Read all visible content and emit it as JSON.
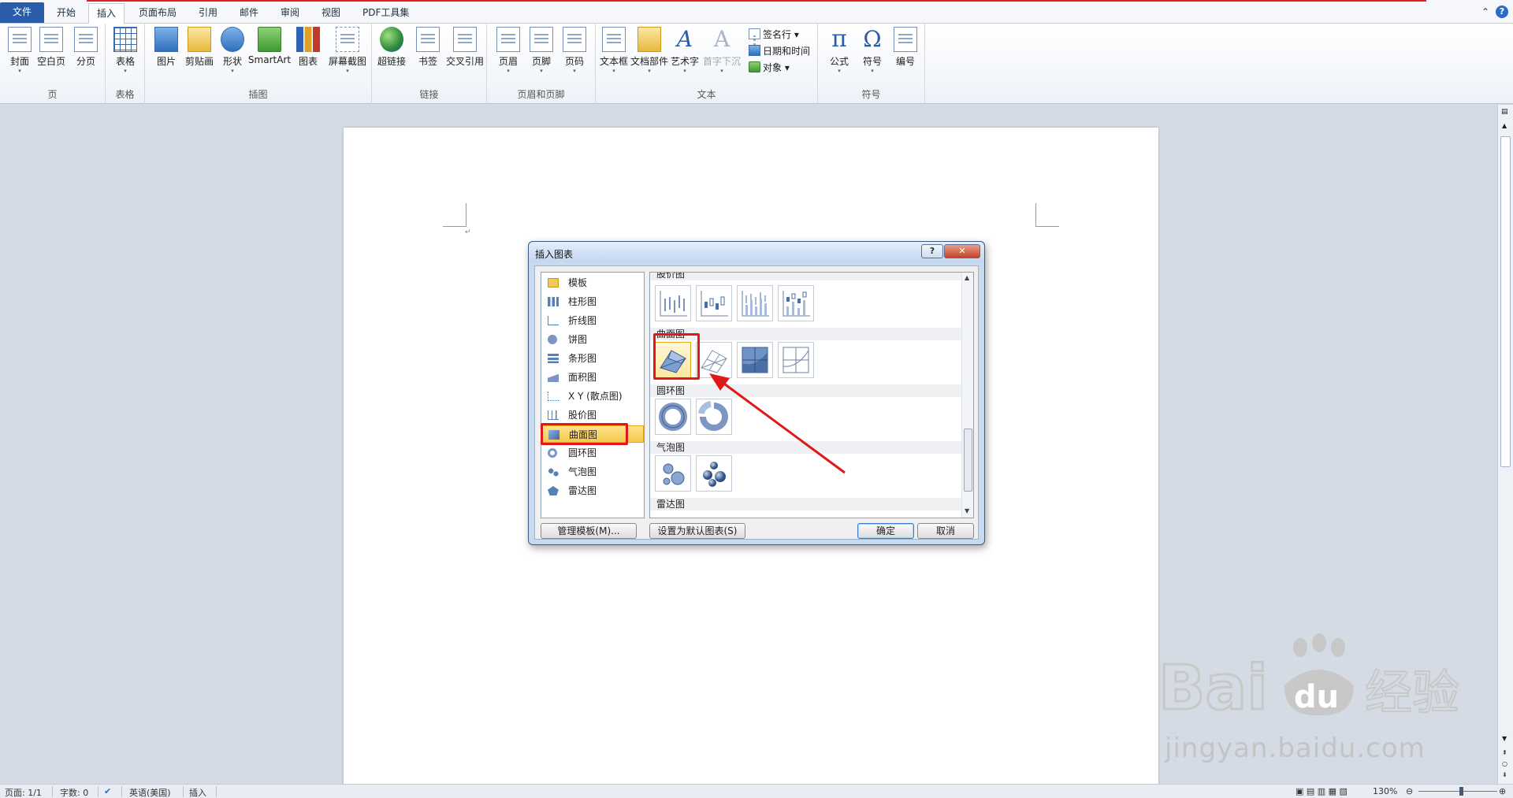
{
  "tabs": [
    {
      "label": "文件"
    },
    {
      "label": "开始"
    },
    {
      "label": "插入"
    },
    {
      "label": "页面布局"
    },
    {
      "label": "引用"
    },
    {
      "label": "邮件"
    },
    {
      "label": "审阅"
    },
    {
      "label": "视图"
    },
    {
      "label": "PDF工具集"
    }
  ],
  "ribbon": {
    "groups": {
      "page": "页",
      "table": "表格",
      "illustration": "插图",
      "links": "链接",
      "header_footer": "页眉和页脚",
      "text": "文本",
      "symbols": "符号"
    },
    "buttons": {
      "cover": "封面",
      "blank": "空白页",
      "pagebreak": "分页",
      "table": "表格",
      "picture": "图片",
      "clipart": "剪贴画",
      "shapes": "形状",
      "smartart": "SmartArt",
      "chart": "图表",
      "screenshot": "屏幕截图",
      "hyperlink": "超链接",
      "bookmark": "书签",
      "crossref": "交叉引用",
      "header": "页眉",
      "footer": "页脚",
      "pagenum": "页码",
      "textbox": "文本框",
      "quickparts": "文档部件",
      "wordart": "艺术字",
      "dropcap": "首字下沉",
      "signature": "签名行 ▾",
      "datetime": "日期和时间",
      "object": "对象 ▾",
      "equation": "公式",
      "symbol": "符号",
      "numbering": "编号"
    }
  },
  "dialog": {
    "title": "插入图表",
    "help": "?",
    "close": "✕",
    "types": [
      {
        "label": "模板"
      },
      {
        "label": "柱形图"
      },
      {
        "label": "折线图"
      },
      {
        "label": "饼图"
      },
      {
        "label": "条形图"
      },
      {
        "label": "面积图"
      },
      {
        "label": "X Y (散点图)"
      },
      {
        "label": "股价图"
      },
      {
        "label": "曲面图"
      },
      {
        "label": "圆环图"
      },
      {
        "label": "气泡图"
      },
      {
        "label": "雷达图"
      }
    ],
    "selected_type": "曲面图",
    "gallery_headers": {
      "stock": "股价图",
      "surface": "曲面图",
      "doughnut": "圆环图",
      "bubble": "气泡图",
      "radar": "雷达图"
    },
    "manage_templates": "管理模板(M)...",
    "set_default": "设置为默认图表(S)",
    "ok": "确定",
    "cancel": "取消"
  },
  "status": {
    "page": "页面: 1/1",
    "words": "字数: 0",
    "language": "英语(美国)",
    "mode": "插入",
    "zoom": "130%"
  },
  "watermark": {
    "text": "jingyan.baidu.com"
  },
  "colors": {
    "accent_red": "#e01818",
    "selection_yellow": "#f6c94c",
    "file_tab": "#2a5caa"
  }
}
